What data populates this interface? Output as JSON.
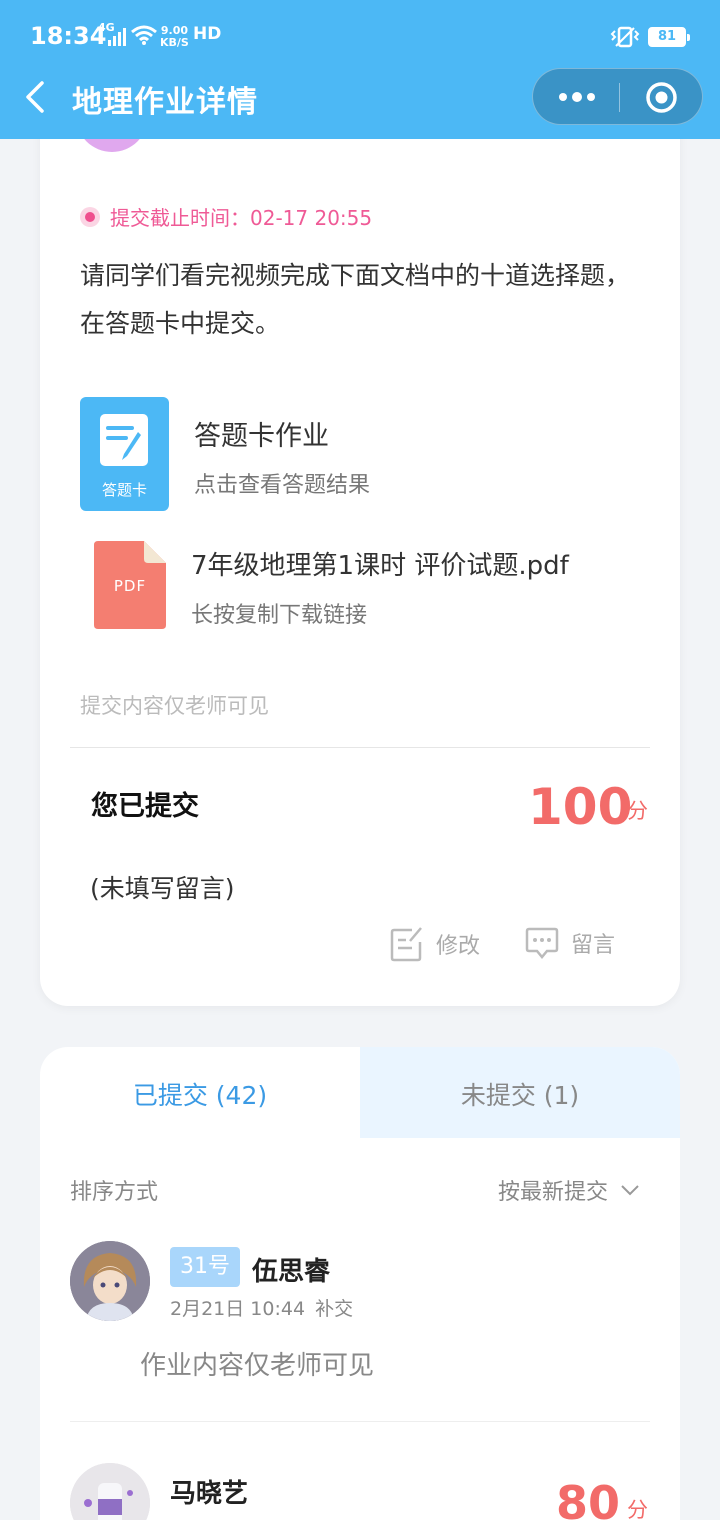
{
  "status": {
    "time": "18:34",
    "net": "4G",
    "speed_top": "9.00",
    "speed_bottom": "KB/S",
    "hd": "HD",
    "battery": "81"
  },
  "header": {
    "title": "地理作业详情"
  },
  "assignment": {
    "deadline": "提交截止时间：02-17 20:55",
    "description": "请同学们看完视频完成下面文档中的十道选择题，在答题卡中提交。",
    "attachments": [
      {
        "icon_label": "答题卡",
        "title": "答题卡作业",
        "subtitle": "点击查看答题结果"
      },
      {
        "icon_label": "PDF",
        "title": "7年级地理第1课时 评价试题.pdf",
        "subtitle": "长按复制下载链接"
      }
    ],
    "visibility_note": "提交内容仅老师可见"
  },
  "my_submission": {
    "status": "您已提交",
    "score": "100",
    "score_unit": "分",
    "comment": "(未填写留言)",
    "edit_label": "修改",
    "message_label": "留言"
  },
  "tabs": [
    {
      "label": "已提交 (42)",
      "active": true
    },
    {
      "label": "未提交 (1)",
      "active": false
    }
  ],
  "sort": {
    "label": "排序方式",
    "value": "按最新提交"
  },
  "submissions": [
    {
      "badge": "31号",
      "name": "伍思睿",
      "time": "2月21日 10:44",
      "tag": "补交",
      "content": "作业内容仅老师可见"
    },
    {
      "name": "马晓艺",
      "score": "80",
      "score_unit": "分"
    }
  ],
  "colors": {
    "primary": "#4cb8f5",
    "score": "#f26b69",
    "deadline": "#ef5a96",
    "tab_active": "#3b9ae4"
  }
}
